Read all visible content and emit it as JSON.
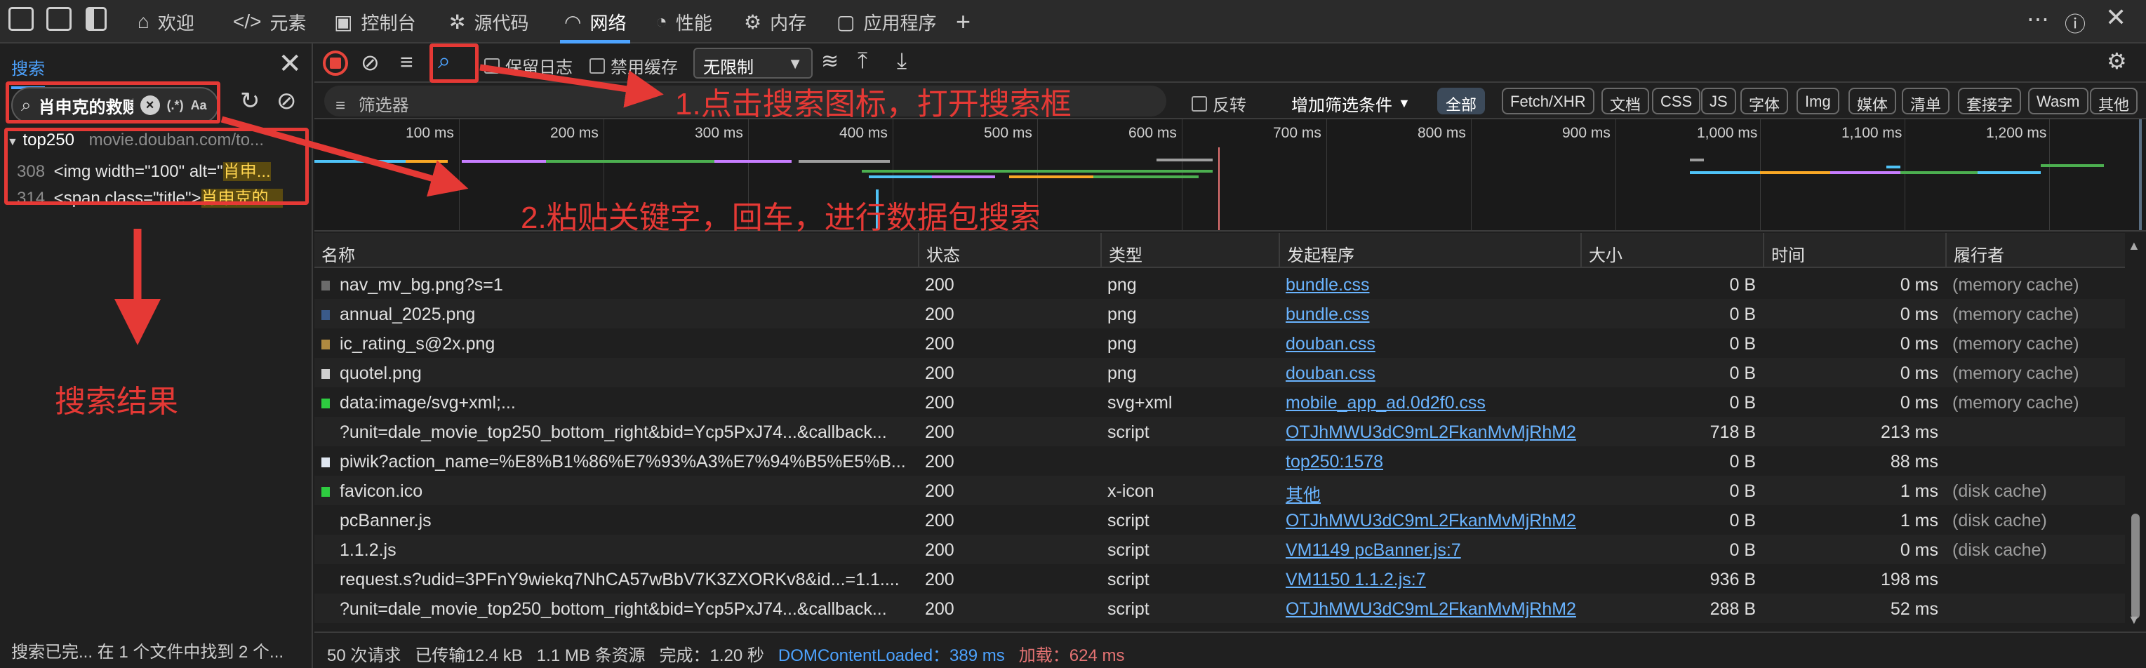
{
  "tabs": [
    {
      "label": "欢迎",
      "icon": "home-icon",
      "active": false
    },
    {
      "label": "元素",
      "icon": "code-icon",
      "active": false
    },
    {
      "label": "控制台",
      "icon": "console-icon",
      "active": false
    },
    {
      "label": "源代码",
      "icon": "bug-icon",
      "active": false
    },
    {
      "label": "网络",
      "icon": "wifi-icon",
      "active": true
    },
    {
      "label": "性能",
      "icon": "gauge-icon",
      "active": false
    },
    {
      "label": "内存",
      "icon": "gear-icon",
      "active": false
    },
    {
      "label": "应用程序",
      "icon": "app-icon",
      "active": false
    }
  ],
  "search": {
    "title": "搜索",
    "query": "肖申克的救赎",
    "regex_label": "(.*)",
    "case_label": "Aa",
    "result_file": "top250",
    "result_path": "movie.douban.com/to...",
    "results": [
      {
        "line": "308",
        "before": "<img width=\"100\" alt=\"",
        "match": "肖申..."
      },
      {
        "line": "314",
        "before": "<span class=\"title\">",
        "match": "肖申克的..."
      }
    ],
    "footer": "搜索已完... 在 1 个文件中找到 2 个..."
  },
  "toolbar": {
    "preserve_log": "保留日志",
    "disable_cache": "禁用缓存",
    "throttle": "无限制"
  },
  "filter": {
    "placeholder": "筛选器",
    "invert": "反转",
    "more_filters": "增加筛选条件",
    "types": [
      "全部",
      "Fetch/XHR",
      "文档",
      "CSS",
      "JS",
      "字体",
      "Img",
      "媒体",
      "清单",
      "套接字",
      "Wasm",
      "其他"
    ]
  },
  "timeline": {
    "ticks": [
      "100 ms",
      "200 ms",
      "300 ms",
      "400 ms",
      "500 ms",
      "600 ms",
      "700 ms",
      "800 ms",
      "900 ms",
      "1,000 ms",
      "1,100 ms",
      "1,200 ms"
    ]
  },
  "table": {
    "columns": [
      "名称",
      "状态",
      "类型",
      "发起程序",
      "大小",
      "时间",
      "履行者"
    ],
    "rows": [
      {
        "name": "nav_mv_bg.png?s=1",
        "status": "200",
        "type": "png",
        "initiator": "bundle.css",
        "size": "0 B",
        "time": "0 ms",
        "fulfilled": "(memory cache)",
        "icon": "#6b6b6b"
      },
      {
        "name": "annual_2025.png",
        "status": "200",
        "type": "png",
        "initiator": "bundle.css",
        "size": "0 B",
        "time": "0 ms",
        "fulfilled": "(memory cache)",
        "icon": "#3a5a8a"
      },
      {
        "name": "ic_rating_s@2x.png",
        "status": "200",
        "type": "png",
        "initiator": "douban.css",
        "size": "0 B",
        "time": "0 ms",
        "fulfilled": "(memory cache)",
        "icon": "#b08a40"
      },
      {
        "name": "quotel.png",
        "status": "200",
        "type": "png",
        "initiator": "douban.css",
        "size": "0 B",
        "time": "0 ms",
        "fulfilled": "(memory cache)",
        "icon": "#cfcfcf"
      },
      {
        "name": "data:image/svg+xml;...",
        "status": "200",
        "type": "svg+xml",
        "initiator": "mobile_app_ad.0d2f0.css",
        "size": "0 B",
        "time": "0 ms",
        "fulfilled": "(memory cache)",
        "icon": "#2ecc40"
      },
      {
        "name": "?unit=dale_movie_top250_bottom_right&bid=Ycp5PxJ74...&callback...",
        "status": "200",
        "type": "script",
        "initiator": "OTJhMWU3dC9mL2FkanMvMjRhM2",
        "size": "718 B",
        "time": "213 ms",
        "fulfilled": "",
        "icon": ""
      },
      {
        "name": "piwik?action_name=%E8%B1%86%E7%93%A3%E7%94%B5%E5%B...",
        "status": "200",
        "type": "",
        "initiator": "top250:1578",
        "size": "0 B",
        "time": "88 ms",
        "fulfilled": "",
        "icon": "#dfe6f0"
      },
      {
        "name": "favicon.ico",
        "status": "200",
        "type": "x-icon",
        "initiator": "其他",
        "size": "0 B",
        "time": "1 ms",
        "fulfilled": "(disk cache)",
        "icon": "#2ecc40"
      },
      {
        "name": "pcBanner.js",
        "status": "200",
        "type": "script",
        "initiator": "OTJhMWU3dC9mL2FkanMvMjRhM2",
        "size": "0 B",
        "time": "1 ms",
        "fulfilled": "(disk cache)",
        "icon": ""
      },
      {
        "name": "1.1.2.js",
        "status": "200",
        "type": "script",
        "initiator": "VM1149 pcBanner.js:7",
        "size": "0 B",
        "time": "0 ms",
        "fulfilled": "(disk cache)",
        "icon": ""
      },
      {
        "name": "request.s?udid=3PFnY9wiekq7NhCA57wBbV7K3ZXORKv8&id...=1.1....",
        "status": "200",
        "type": "script",
        "initiator": "VM1150 1.1.2.js:7",
        "size": "936 B",
        "time": "198 ms",
        "fulfilled": "",
        "icon": ""
      },
      {
        "name": "?unit=dale_movie_top250_bottom_right&bid=Ycp5PxJ74...&callback...",
        "status": "200",
        "type": "script",
        "initiator": "OTJhMWU3dC9mL2FkanMvMjRhM2",
        "size": "288 B",
        "time": "52 ms",
        "fulfilled": "",
        "icon": ""
      }
    ]
  },
  "status": {
    "requests": "50 次请求",
    "transferred": "已传输12.4 kB",
    "resources": "1.1 MB 条资源",
    "finish": "完成：1.20 秒",
    "dcl": "DOMContentLoaded：389 ms",
    "load": "加载：624 ms"
  },
  "annotations": {
    "step1": "1.点击搜索图标，打开搜索框",
    "step2": "2.粘贴关键字，回车，进行数据包搜索",
    "results_label": "搜索结果"
  },
  "colors": {
    "accent": "#4da3ff",
    "annotation": "#e53935",
    "record": "#e8453c"
  }
}
